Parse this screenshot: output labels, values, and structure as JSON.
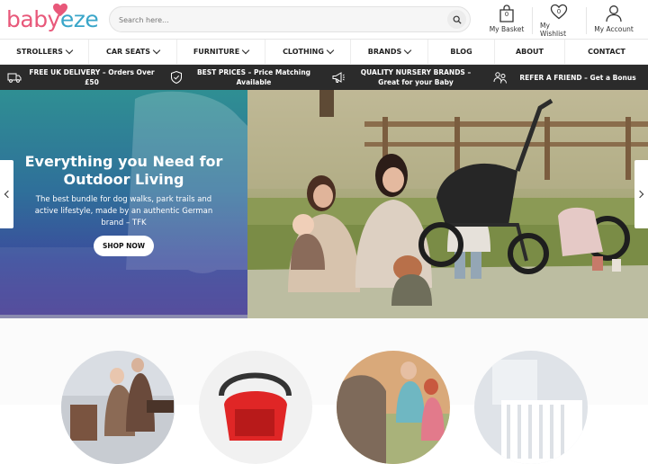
{
  "header": {
    "logo": {
      "part1": "baby",
      "part2": "eze"
    },
    "search": {
      "placeholder": "Search here..."
    },
    "basket": {
      "label": "My Basket",
      "count": "0"
    },
    "wishlist": {
      "label": "My Wishlist",
      "count": "0"
    },
    "account": {
      "label": "My Account"
    }
  },
  "nav": {
    "items": [
      {
        "label": "STROLLERS",
        "dropdown": true
      },
      {
        "label": "CAR SEATS",
        "dropdown": true
      },
      {
        "label": "FURNITURE",
        "dropdown": true
      },
      {
        "label": "CLOTHING",
        "dropdown": true
      },
      {
        "label": "BRANDS",
        "dropdown": true
      },
      {
        "label": "BLOG",
        "dropdown": false
      },
      {
        "label": "ABOUT",
        "dropdown": false
      },
      {
        "label": "CONTACT",
        "dropdown": false
      }
    ]
  },
  "usp": [
    {
      "icon": "delivery-truck-icon",
      "text": "FREE UK DELIVERY – Orders Over £50"
    },
    {
      "icon": "shield-check-icon",
      "text": "BEST PRICES – Price Matching Available"
    },
    {
      "icon": "megaphone-icon",
      "text": "QUALITY NURSERY BRANDS – Great for your Baby"
    },
    {
      "icon": "refer-friend-icon",
      "text": "REFER A FRIEND – Get a Bonus"
    }
  ],
  "hero": {
    "title": "Everything you Need for Outdoor Living",
    "subtitle": "The best bundle for dog walks, park trails and active lifestyle, made by an authentic German brand – TFK",
    "button": "SHOP NOW"
  },
  "colors": {
    "brand_pink": "#e8587a",
    "brand_blue": "#3aa6c9",
    "usp_bar": "#2b2b2b"
  }
}
